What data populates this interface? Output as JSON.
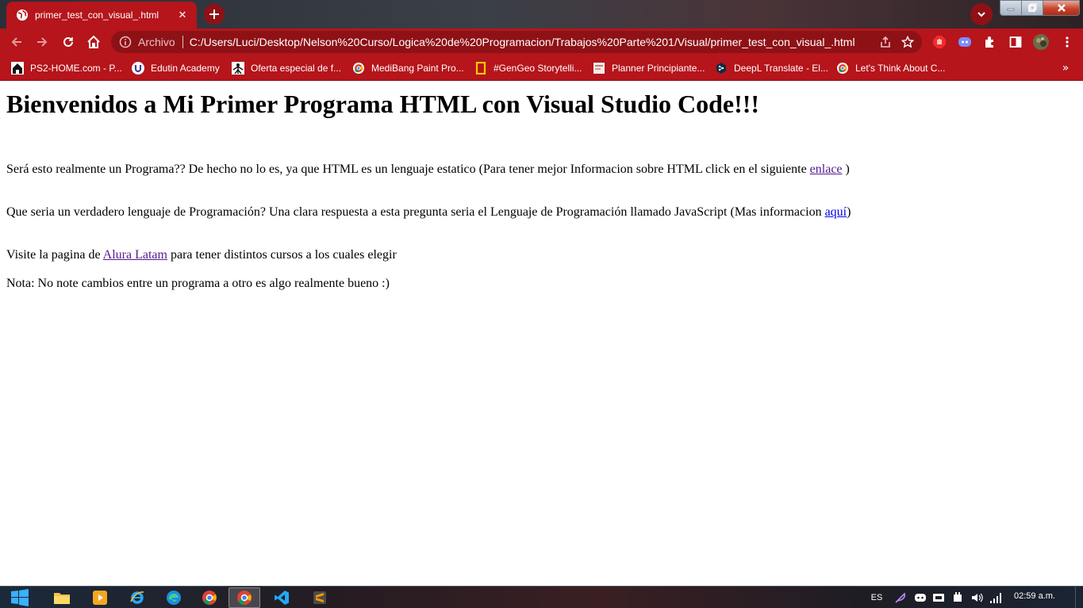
{
  "browser": {
    "tab": {
      "title": "primer_test_con_visual_.html",
      "close_symbol": "✕",
      "favicon": "globe-icon"
    },
    "new_tab_symbol": "+",
    "omnibox": {
      "security_label": "Archivo",
      "url": "C:/Users/Luci/Desktop/Nelson%20Curso/Logica%20de%20Programacion/Trabajos%20Parte%201/Visual/primer_test_con_visual_.html"
    },
    "theme_color": "#b5151b",
    "theme_dark": "#8e1116",
    "bookmarks": [
      {
        "label": "PS2-HOME.com - P...",
        "icon": "ps2-home-icon"
      },
      {
        "label": "Edutin Academy",
        "icon": "edutin-icon"
      },
      {
        "label": "Oferta especial de f...",
        "icon": "sena-icon"
      },
      {
        "label": "MediBang Paint Pro...",
        "icon": "chrome-app-icon"
      },
      {
        "label": "#GenGeo Storytelli...",
        "icon": "natgeo-icon"
      },
      {
        "label": "Planner Principiante...",
        "icon": "planner-icon"
      },
      {
        "label": "DeepL Translate - El...",
        "icon": "deepl-icon"
      },
      {
        "label": "Let's Think About C...",
        "icon": "chrome-app-icon"
      }
    ],
    "bookmarks_overflow": "»"
  },
  "page": {
    "heading": "Bienvenidos a Mi Primer Programa HTML con Visual Studio Code!!!",
    "p1": {
      "text": "Será esto realmente un Programa?? De hecho no lo es, ya que HTML es un lenguaje estatico (Para tener mejor Informacion sobre HTML click en el siguiente ",
      "link": "enlace",
      "after": " )"
    },
    "p2": {
      "text": "Que seria un verdadero lenguaje de Programación? Una clara respuesta a esta pregunta seria el Lenguaje de Programación llamado JavaScript (Mas informacion ",
      "link": "aquí",
      "after": ")"
    },
    "p3": {
      "text": "Visite la pagina de ",
      "link": "Alura Latam",
      "after": " para tener distintos cursos a los cuales elegir"
    },
    "p4": {
      "text": "Nota: No note cambios entre un programa a otro es algo realmente bueno :)"
    }
  },
  "taskbar": {
    "apps": [
      "file-explorer-icon",
      "media-player-icon",
      "internet-explorer-icon",
      "edge-icon",
      "chrome-icon",
      "chrome-active-icon",
      "vscode-icon",
      "sublime-text-icon"
    ],
    "language": "ES",
    "clock": "02:59 a.m."
  }
}
